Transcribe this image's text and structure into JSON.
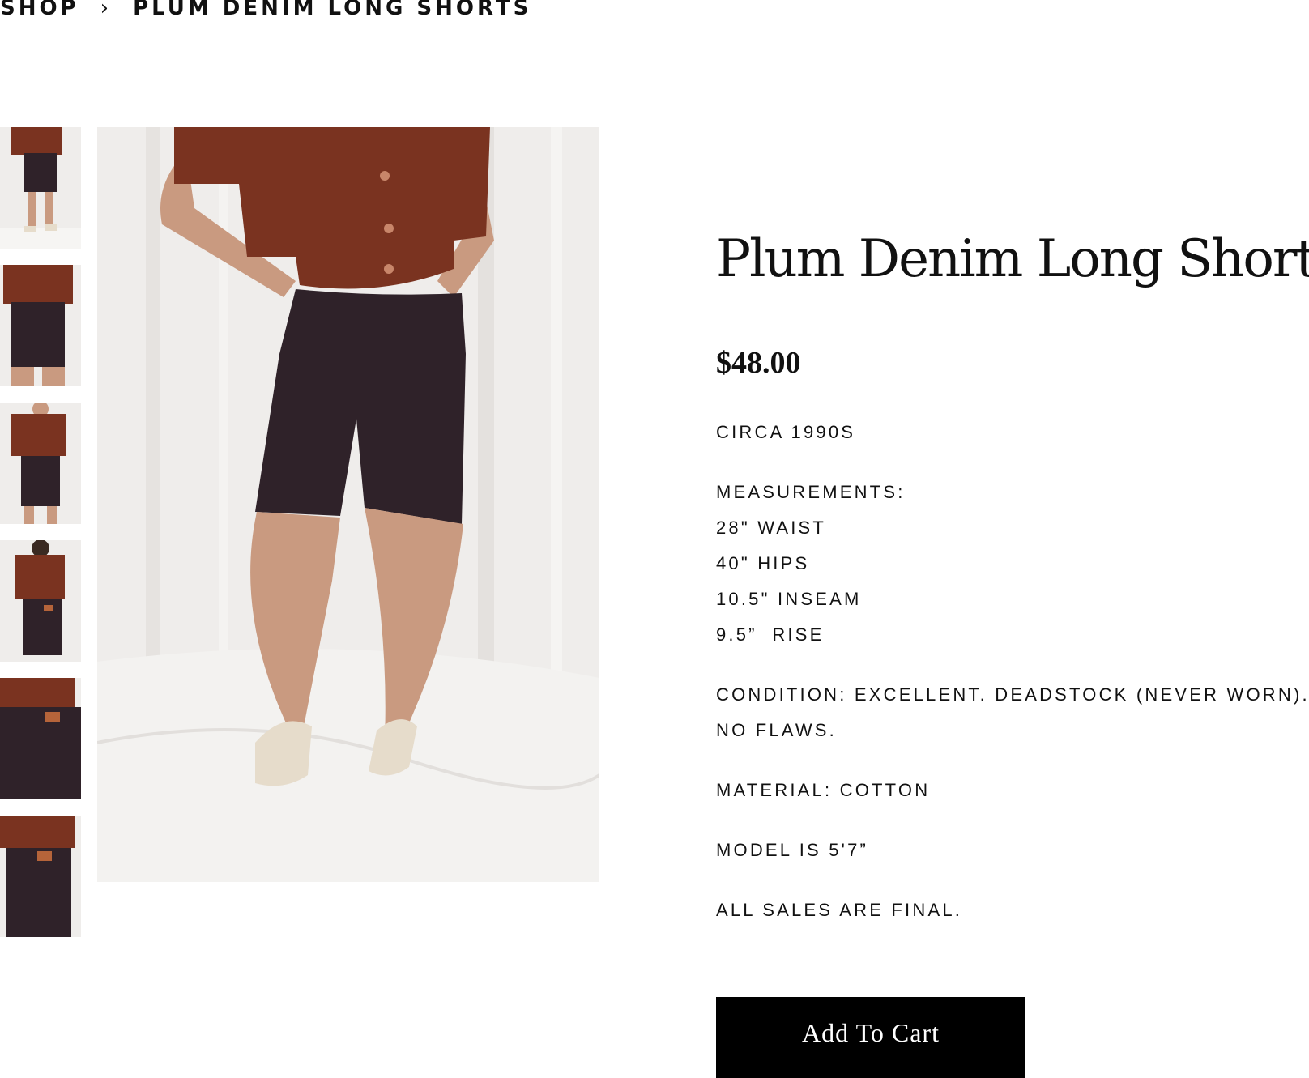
{
  "breadcrumb": {
    "shop": "SHOP",
    "separator": "›",
    "current": "PLUM DENIM LONG SHORTS"
  },
  "product": {
    "title": "Plum Denim Long Shorts",
    "price": "$48.00",
    "era": "CIRCA 1990S",
    "measurements_heading": "MEASUREMENTS:",
    "measurements": [
      "28\" WAIST",
      "40\" HIPS",
      "10.5\" INSEAM",
      "9.5”  RISE"
    ],
    "condition": "CONDITION: EXCELLENT. DEADSTOCK (NEVER WORN). NO FLAWS.",
    "material": "MATERIAL: COTTON",
    "model": "MODEL IS 5'7”",
    "sales_note": "ALL SALES ARE FINAL.",
    "add_to_cart_label": "Add To Cart"
  },
  "colors": {
    "shirt": "#7a3320",
    "shorts": "#2f2229",
    "backdrop": "#efedeb",
    "skin": "#c99a80",
    "sandals": "#e6dccb",
    "button_bg": "#000000"
  }
}
